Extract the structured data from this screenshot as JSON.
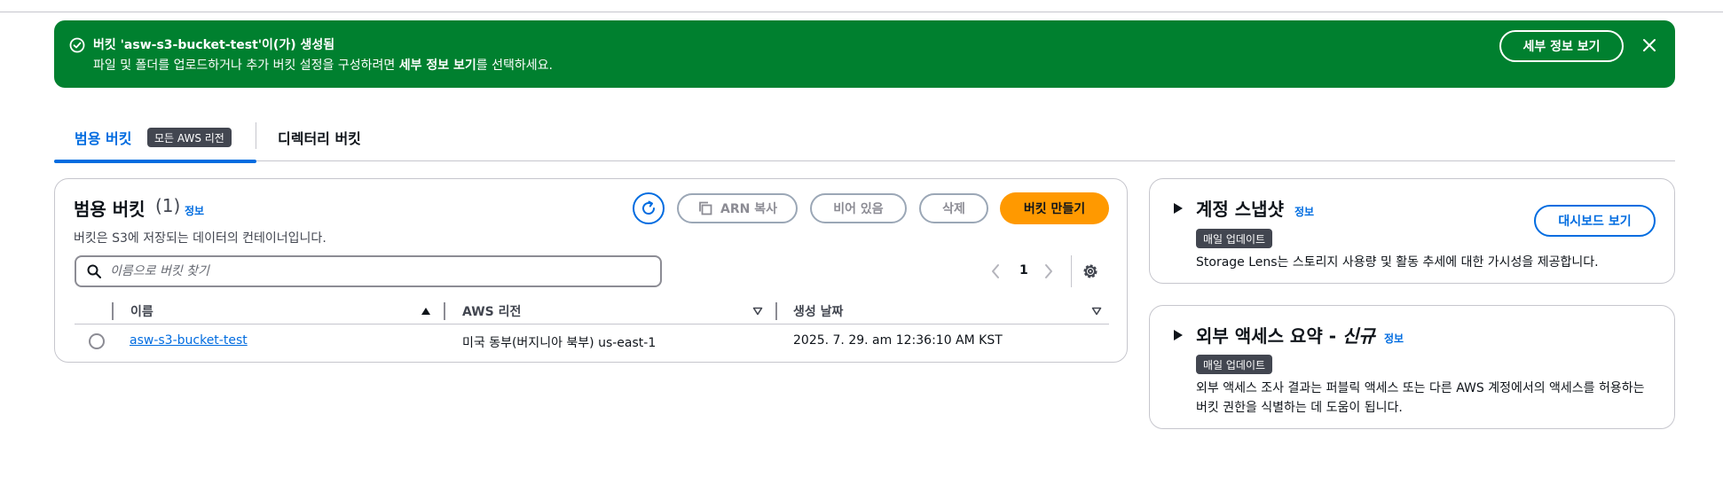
{
  "flash": {
    "title": "버킷 'asw-s3-bucket-test'이(가) 생성됨",
    "message_before": "파일 및 폴더를 업로드하거나 추가 버킷 설정을 구성하려면 ",
    "message_bold": "세부 정보 보기",
    "message_after": "를 선택하세요.",
    "view_details_label": "세부 정보 보기",
    "icon": "check-circle-icon",
    "background": "#00802f"
  },
  "tabs": {
    "general": {
      "label": "범용 버킷",
      "badge": "모든 AWS 리전"
    },
    "directory": {
      "label": "디렉터리 버킷"
    },
    "active_color": "#006ce0"
  },
  "buckets": {
    "heading": "범용 버킷",
    "count": "(1)",
    "info_label": "정보",
    "description": "버킷은 S3에 저장되는 데이터의 컨테이너입니다.",
    "actions": {
      "copy_arn": "ARN 복사",
      "empty": "비어 있음",
      "delete": "삭제",
      "create": "버킷 만들기"
    },
    "search_placeholder": "이름으로 버킷 찾기",
    "page": "1",
    "columns": [
      "이름",
      "AWS 리전",
      "생성 날짜"
    ],
    "rows": [
      {
        "name": "asw-s3-bucket-test",
        "region": "미국 동부(버지니아 북부) us-east-1",
        "created": "2025. 7. 29. am 12:36:10 AM KST"
      }
    ],
    "create_color": "#ff9900"
  },
  "snapshot": {
    "title": "계정 스냅샷",
    "info_label": "정보",
    "badge": "매일 업데이트",
    "description": "Storage Lens는 스토리지 사용량 및 활동 추세에 대한 가시성을 제공합니다.",
    "dashboard_button": "대시보드 보기"
  },
  "external_access": {
    "title": "외부 액세스 요약 - ",
    "title_new": "신규",
    "info_label": "정보",
    "badge": "매일 업데이트",
    "description": "외부 액세스 조사 결과는 퍼블릭 액세스 또는 다른 AWS 계정에서의 액세스를 허용하는 버킷 권한을 식별하는 데 도움이 됩니다."
  }
}
